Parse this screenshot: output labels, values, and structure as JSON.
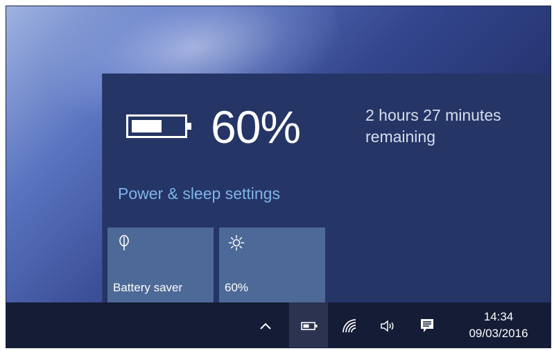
{
  "battery": {
    "percent_label": "60%",
    "time_remaining": "2 hours 27 minutes remaining",
    "charge_level_percent": 60
  },
  "flyout": {
    "settings_link": "Power & sleep settings"
  },
  "quick_actions": [
    {
      "label": "Battery saver",
      "icon": "leaf-icon"
    },
    {
      "label": "60%",
      "icon": "brightness-icon"
    }
  ],
  "taskbar": {
    "clock": {
      "time": "14:34",
      "date": "09/03/2016"
    },
    "icons": [
      "chevron-up-icon",
      "battery-icon",
      "wifi-icon",
      "volume-icon",
      "action-center-icon"
    ]
  },
  "colors": {
    "flyout_bg": "#253566",
    "tile_bg": "#4d6997",
    "link": "#7fb4ea",
    "taskbar_bg": "#141c36"
  }
}
